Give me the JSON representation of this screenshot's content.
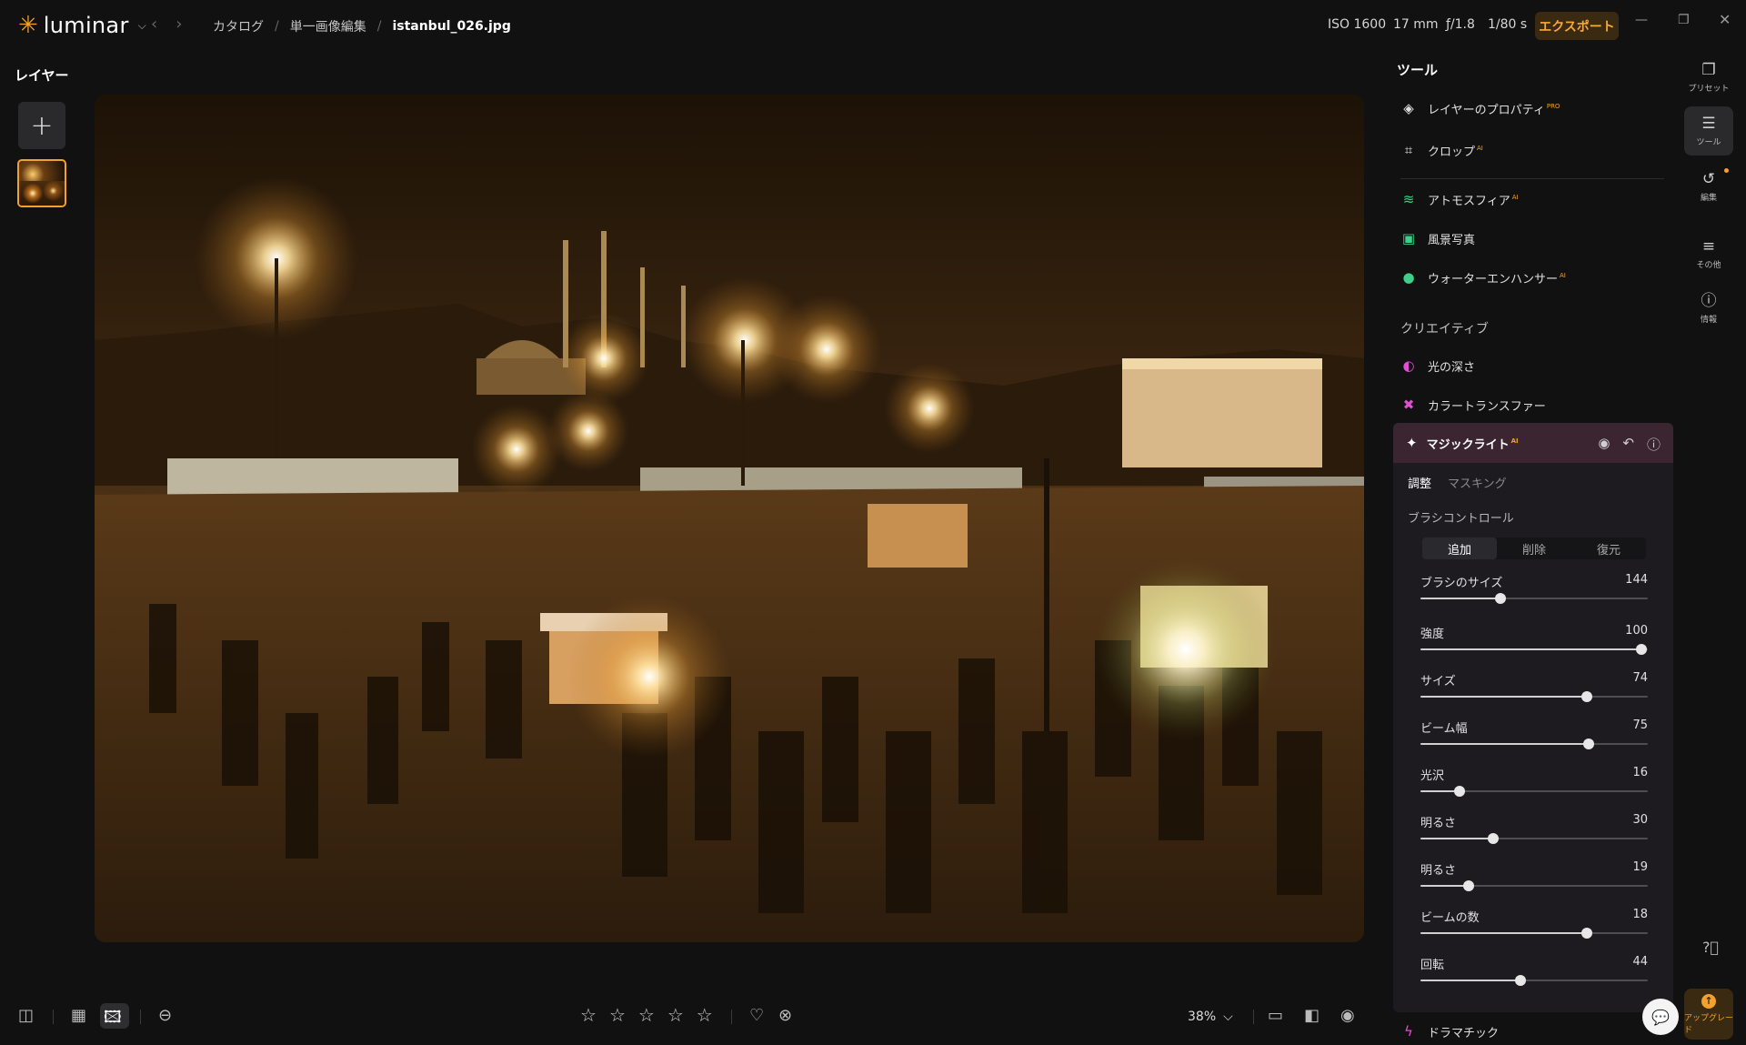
{
  "app": {
    "name": "luminar"
  },
  "breadcrumb": {
    "items": [
      "カタログ",
      "単一画像編集",
      "istanbul_026.jpg"
    ]
  },
  "exif": {
    "iso": "ISO 1600",
    "focal": "17 mm",
    "aperture": "ƒ/1.8",
    "shutter": "1/80 s"
  },
  "toolbar": {
    "export_label": "エクスポート"
  },
  "layers": {
    "title": "レイヤー",
    "add": "+"
  },
  "tools": {
    "title": "ツール",
    "items": [
      {
        "label": "レイヤーのプロパティ",
        "badge": "PRO"
      },
      {
        "label": "クロップ",
        "badge": "AI"
      },
      {
        "label": "アトモスフィア",
        "badge": "AI"
      },
      {
        "label": "風景写真",
        "badge": ""
      },
      {
        "label": "ウォーターエンハンサー",
        "badge": "AI"
      }
    ],
    "creative_label": "クリエイティブ",
    "creative_items": [
      {
        "label": "光の深さ",
        "badge": ""
      },
      {
        "label": "カラートランスファー",
        "badge": ""
      }
    ],
    "magic_light": {
      "title": "マジックライト",
      "badge": "AI",
      "tabs": [
        "調整",
        "マスキング"
      ],
      "brush_control_label": "ブラシコントロール",
      "brush_modes": [
        "追加",
        "削除",
        "復元"
      ],
      "sliders": [
        {
          "label": "ブラシのサイズ",
          "value": 144,
          "fraction": 0.35
        },
        {
          "label": "強度",
          "value": 100,
          "fraction": 0.97
        },
        {
          "label": "サイズ",
          "value": 74,
          "fraction": 0.73
        },
        {
          "label": "ビーム幅",
          "value": 75,
          "fraction": 0.74
        },
        {
          "label": "光沢",
          "value": 16,
          "fraction": 0.17
        },
        {
          "label": "明るさ",
          "value": 30,
          "fraction": 0.32
        },
        {
          "label": "明るさ",
          "value": 19,
          "fraction": 0.21
        },
        {
          "label": "ビームの数",
          "value": 18,
          "fraction": 0.73
        },
        {
          "label": "回転",
          "value": 44,
          "fraction": 0.44
        }
      ]
    },
    "next_item": {
      "label": "ドラマチック"
    }
  },
  "rail": {
    "presets": "プリセット",
    "tools": "ツール",
    "edits": "編集",
    "more": "その他",
    "info": "情報",
    "upgrade": "アップグレード"
  },
  "bottombar": {
    "zoom": "38%"
  },
  "colors": {
    "accent": "#f2a12c",
    "card_header": "#3a2530"
  }
}
